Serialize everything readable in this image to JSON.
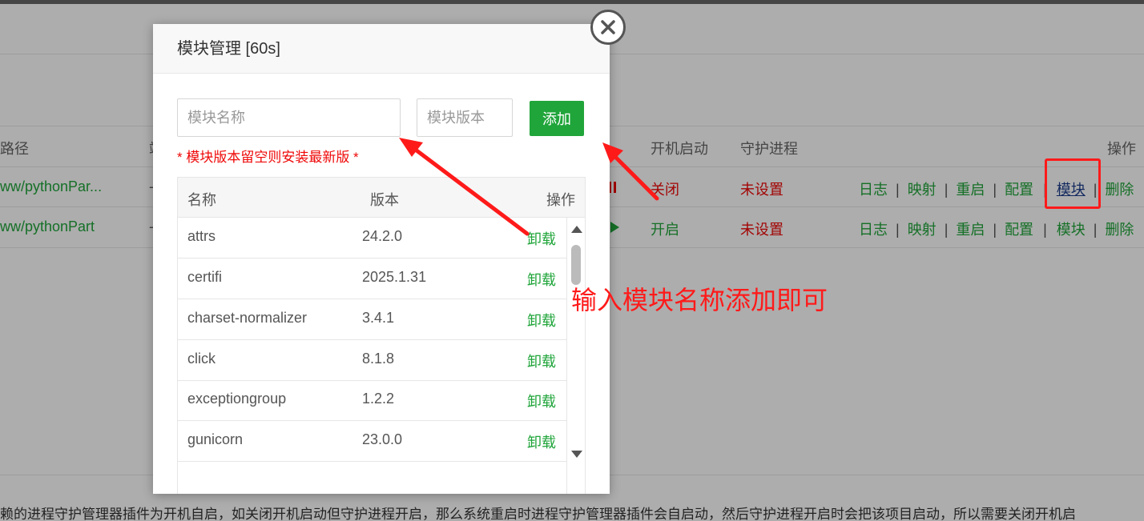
{
  "background": {
    "headers": {
      "path": "路径",
      "col2": "端",
      "boot": "开机启动",
      "guard": "守护进程",
      "ops": "操作"
    },
    "rows": [
      {
        "path": "ww/pythonPar...",
        "dash": "-",
        "boot": "关闭",
        "guard": "未设置",
        "ops": [
          "日志",
          "映射",
          "重启",
          "配置",
          "模块",
          "删除"
        ]
      },
      {
        "path": "ww/pythonPart",
        "dash": "-",
        "boot": "开启",
        "guard": "未设置",
        "ops": [
          "日志",
          "映射",
          "重启",
          "配置",
          "模块",
          "删除"
        ]
      }
    ],
    "footer_text": "赖的进程守护管理器插件为开机自启，如关闭开机启动但守护进程开启，那么系统重启时进程守护管理器插件会自启动，然后守护进程开启时会把该项目启动，所以需要关闭开机启"
  },
  "modal": {
    "title": "模块管理 [60s]",
    "name_placeholder": "模块名称",
    "version_placeholder": "模块版本",
    "add_label": "添加",
    "hint": "* 模块版本留空则安装最新版 *",
    "table": {
      "headers": [
        "名称",
        "版本",
        "操作"
      ],
      "rows": [
        {
          "name": "attrs",
          "version": "24.2.0",
          "action": "卸载"
        },
        {
          "name": "certifi",
          "version": "2025.1.31",
          "action": "卸载"
        },
        {
          "name": "charset-normalizer",
          "version": "3.4.1",
          "action": "卸载"
        },
        {
          "name": "click",
          "version": "8.1.8",
          "action": "卸载"
        },
        {
          "name": "exceptiongroup",
          "version": "1.2.2",
          "action": "卸载"
        },
        {
          "name": "gunicorn",
          "version": "23.0.0",
          "action": "卸载"
        }
      ]
    }
  },
  "annotation": {
    "text": "输入模块名称添加即可",
    "color": "#ff1a1a"
  },
  "colors": {
    "accent_green": "#20a53a",
    "danger_red": "#ef0808"
  }
}
